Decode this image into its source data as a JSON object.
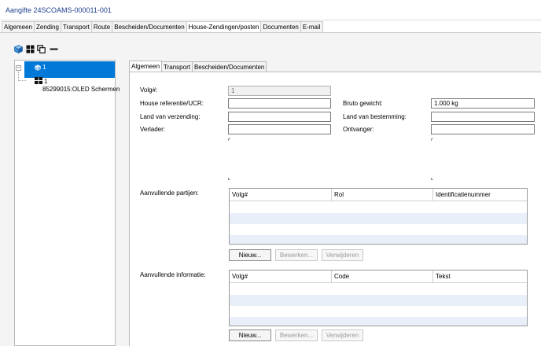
{
  "window": {
    "title": "Aangifte 24SCOAMS-000011-001"
  },
  "top_tabs": [
    {
      "label": "Algemeen"
    },
    {
      "label": "Zending"
    },
    {
      "label": "Transport"
    },
    {
      "label": "Route"
    },
    {
      "label": "Bescheiden/Documenten"
    },
    {
      "label": "House-Zendingen/posten",
      "active": true
    },
    {
      "label": "Documenten"
    },
    {
      "label": "E-mail"
    }
  ],
  "toolbar": {
    "icons": [
      "cube-icon",
      "grid-icon",
      "copy-icon",
      "minus-icon"
    ]
  },
  "tree": {
    "root": {
      "label": "1",
      "toggle": "−"
    },
    "child": {
      "label": "1",
      "description": "85299015:OLED Schermen"
    }
  },
  "inner_tabs": [
    {
      "label": "Algemeen",
      "active": true
    },
    {
      "label": "Transport"
    },
    {
      "label": "Bescheiden/Documenten"
    }
  ],
  "form": {
    "volg_label": "Volg#:",
    "volg_value": "1",
    "house_ref_label": "House referentie/UCR:",
    "house_ref_value": "",
    "land_verzending_label": "Land van verzending:",
    "land_verzending_value": "",
    "verlader_label": "Verlader:",
    "verlader_value": "",
    "bruto_label": "Bruto gewicht:",
    "bruto_value": "1.000 kg",
    "land_bestemming_label": "Land van bestemming:",
    "land_bestemming_value": "",
    "ontvanger_label": "Ontvanger:",
    "ontvanger_value": ""
  },
  "partijen": {
    "label": "Aanvullende partijen:",
    "columns": [
      "Volg#",
      "Rol",
      "Identificatienummer"
    ],
    "buttons": {
      "new": "Nieuw...",
      "edit": "Bewerken...",
      "delete": "Verwijderen"
    }
  },
  "informatie": {
    "label": "Aanvullende informatie:",
    "columns": [
      "Volg#",
      "Code",
      "Tekst"
    ],
    "buttons": {
      "new": "Nieuw...",
      "edit": "Bewerken...",
      "delete": "Verwijderen"
    }
  },
  "colors": {
    "selection": "#0078d7",
    "title": "#1f3f8f",
    "alt_row": "#e9eff8"
  }
}
